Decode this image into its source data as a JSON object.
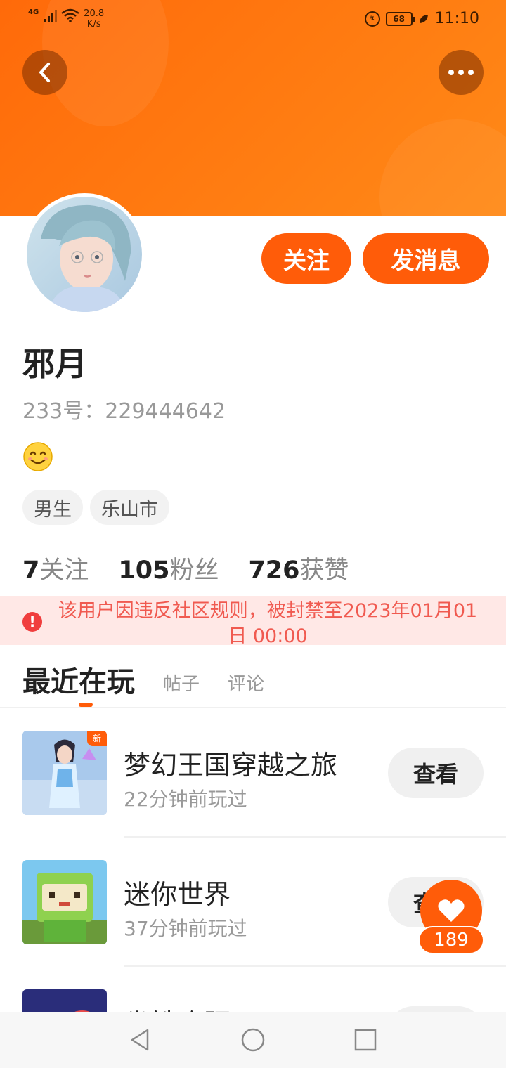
{
  "status_bar": {
    "network": "4G",
    "speed": "20.8",
    "speed_unit": "K/s",
    "battery": "68",
    "time": "11:10"
  },
  "header": {
    "back_icon": "back-arrow-icon",
    "more_icon": "more-dots-icon",
    "colors": {
      "banner": "#ff7512",
      "accent": "#ff5c09"
    }
  },
  "profile": {
    "follow_label": "关注",
    "message_label": "发消息",
    "name": "邪月",
    "uid_label": "233号：",
    "uid": "229444642",
    "bio_emoji": "😊",
    "tags": [
      "男生",
      "乐山市"
    ],
    "stats": [
      {
        "value": "7",
        "label": "关注"
      },
      {
        "value": "105",
        "label": "粉丝"
      },
      {
        "value": "726",
        "label": "获赞"
      }
    ]
  },
  "ban_notice": {
    "icon": "warning-icon",
    "text": "该用户因违反社区规则，被封禁至2023年01月01日 00:00"
  },
  "tabs": {
    "active": "最近在玩",
    "others": [
      "帖子",
      "评论"
    ]
  },
  "games": [
    {
      "title": "梦幻王国穿越之旅",
      "subtitle": "22分钟前玩过",
      "button": "查看",
      "badge": "新"
    },
    {
      "title": "迷你世界",
      "subtitle": "37分钟前玩过",
      "button": "查看",
      "badge": ""
    },
    {
      "title": "坐铁咆趼",
      "subtitle": "",
      "button": "",
      "badge": ""
    }
  ],
  "like": {
    "icon": "heart-icon",
    "count": "189"
  },
  "nav": [
    "back-triangle-icon",
    "home-circle-icon",
    "recents-square-icon"
  ]
}
